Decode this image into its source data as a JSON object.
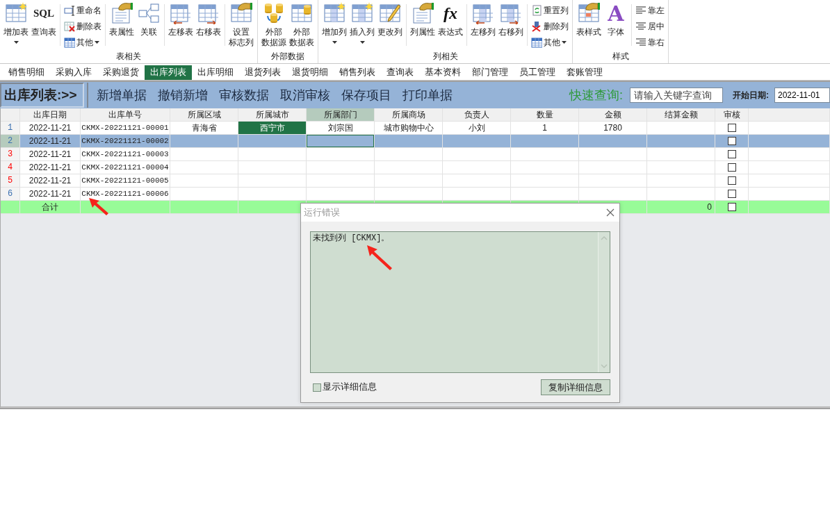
{
  "ribbon": {
    "groups": [
      {
        "label": "表相关",
        "items": [
          {
            "kind": "large",
            "label": "增加表",
            "dropdown": true
          },
          {
            "kind": "large",
            "label": "查询表",
            "icon_text": "SQL",
            "dropdown": false
          },
          {
            "kind": "separator"
          },
          {
            "kind": "stack",
            "items": [
              {
                "label": "重命名",
                "dropdown": false
              },
              {
                "label": "删除表",
                "dropdown": false
              },
              {
                "label": "其他",
                "dropdown": true
              }
            ]
          },
          {
            "kind": "separator"
          },
          {
            "kind": "large",
            "label": "表属性",
            "dropdown": false
          },
          {
            "kind": "large",
            "label": "关联",
            "dropdown": false
          },
          {
            "kind": "separator"
          },
          {
            "kind": "large",
            "label": "左移表",
            "dropdown": false
          },
          {
            "kind": "large",
            "label": "右移表",
            "dropdown": false
          },
          {
            "kind": "separator"
          },
          {
            "kind": "large",
            "label": [
              "设置",
              "标志列"
            ],
            "dropdown": false
          }
        ]
      },
      {
        "label": "外部数据",
        "items": [
          {
            "kind": "large",
            "label": [
              "外部",
              "数据源"
            ],
            "dropdown": false
          },
          {
            "kind": "large",
            "label": [
              "外部",
              "数据表"
            ],
            "dropdown": false
          }
        ]
      },
      {
        "label": "列相关",
        "items": [
          {
            "kind": "large",
            "label": "增加列",
            "dropdown": true
          },
          {
            "kind": "large",
            "label": "插入列",
            "dropdown": true
          },
          {
            "kind": "large",
            "label": "更改列",
            "dropdown": false
          },
          {
            "kind": "separator"
          },
          {
            "kind": "large",
            "label": "列属性",
            "dropdown": false
          },
          {
            "kind": "large",
            "label": "表达式",
            "icon_text": "fx",
            "dropdown": false
          },
          {
            "kind": "separator"
          },
          {
            "kind": "large",
            "label": "左移列",
            "dropdown": false
          },
          {
            "kind": "large",
            "label": "右移列",
            "dropdown": false
          },
          {
            "kind": "separator"
          },
          {
            "kind": "stack",
            "items": [
              {
                "label": "重置列",
                "dropdown": false
              },
              {
                "label": "删除列",
                "dropdown": false
              },
              {
                "label": "其他",
                "dropdown": true
              }
            ]
          }
        ]
      },
      {
        "label": "样式",
        "items": [
          {
            "kind": "large",
            "label": "表样式",
            "dropdown": false
          },
          {
            "kind": "large",
            "label": "字体",
            "icon_text": "A",
            "dropdown": false
          },
          {
            "kind": "separator"
          },
          {
            "kind": "stack",
            "items": [
              {
                "label": "靠左",
                "dropdown": false
              },
              {
                "label": "居中",
                "dropdown": false
              },
              {
                "label": "靠右",
                "dropdown": false
              }
            ]
          }
        ]
      }
    ]
  },
  "tabs": [
    {
      "label": "销售明细",
      "selected": false
    },
    {
      "label": "采购入库",
      "selected": false
    },
    {
      "label": "采购退货",
      "selected": false
    },
    {
      "label": "出库列表",
      "selected": true
    },
    {
      "label": "出库明细",
      "selected": false
    },
    {
      "label": "退货列表",
      "selected": false
    },
    {
      "label": "退货明细",
      "selected": false
    },
    {
      "label": "销售列表",
      "selected": false
    },
    {
      "label": "查询表",
      "selected": false
    },
    {
      "label": "基本资料",
      "selected": false
    },
    {
      "label": "部门管理",
      "selected": false
    },
    {
      "label": "员工管理",
      "selected": false
    },
    {
      "label": "套账管理",
      "selected": false
    }
  ],
  "toolbar": {
    "title": "出库列表:>>",
    "actions": [
      "新增单据",
      "撤销新增",
      "审核数据",
      "取消审核",
      "保存项目",
      "打印单据"
    ],
    "quick_search_label": "快速查询:",
    "search": {
      "placeholder": "请输入关键字查询"
    },
    "date_label": "开始日期:",
    "start_date": "2022-11-01"
  },
  "table": {
    "columns": [
      {
        "label": "出库日期",
        "selected": false
      },
      {
        "label": "出库单号",
        "selected": false
      },
      {
        "label": "所属区域",
        "selected": false
      },
      {
        "label": "所属城市",
        "selected": false
      },
      {
        "label": "所属部门",
        "selected": true
      },
      {
        "label": "所属商场",
        "selected": false
      },
      {
        "label": "负责人",
        "selected": false
      },
      {
        "label": "数量",
        "selected": false
      },
      {
        "label": "金额",
        "selected": false
      },
      {
        "label": "结算金额",
        "selected": false
      },
      {
        "label": "审核",
        "selected": false
      }
    ],
    "rows": [
      {
        "number": "1",
        "color": "#3a6fb0",
        "selected": false,
        "checked": false,
        "cells": [
          {
            "text": "2022-11-21",
            "highlighted": false,
            "focused": false
          },
          {
            "text": "CKMX-20221121-00001",
            "highlighted": false,
            "focused": false
          },
          {
            "text": "青海省",
            "highlighted": false,
            "focused": false
          },
          {
            "text": "西宁市",
            "highlighted": true,
            "focused": false
          },
          {
            "text": "刘宗国",
            "highlighted": false,
            "focused": false
          },
          {
            "text": "城市购物中心",
            "highlighted": false,
            "focused": false
          },
          {
            "text": "小刘",
            "highlighted": false,
            "focused": false
          },
          {
            "text": "1",
            "highlighted": false,
            "focused": false
          },
          {
            "text": "1780",
            "highlighted": false,
            "focused": false
          }
        ]
      },
      {
        "number": "2",
        "color": "#3a6fb0",
        "selected": true,
        "checked": false,
        "cells": [
          {
            "text": "2022-11-21",
            "highlighted": false,
            "focused": false
          },
          {
            "text": "CKMX-20221121-00002",
            "highlighted": false,
            "focused": false
          },
          {
            "highlighted": false,
            "focused": false
          },
          {
            "highlighted": false,
            "focused": false
          },
          {
            "highlighted": false,
            "focused": true
          }
        ]
      },
      {
        "number": "3",
        "color": "#ff0000",
        "selected": false,
        "checked": false,
        "cells": [
          {
            "text": "2022-11-21",
            "highlighted": false,
            "focused": false
          },
          {
            "text": "CKMX-20221121-00003",
            "highlighted": false,
            "focused": false
          }
        ]
      },
      {
        "number": "4",
        "color": "#ff0000",
        "selected": false,
        "checked": false,
        "cells": [
          {
            "text": "2022-11-21",
            "highlighted": false,
            "focused": false
          },
          {
            "text": "CKMX-20221121-00004",
            "highlighted": false,
            "focused": false
          }
        ]
      },
      {
        "number": "5",
        "color": "#ff0000",
        "selected": false,
        "checked": false,
        "cells": [
          {
            "text": "2022-11-21",
            "highlighted": false,
            "focused": false
          },
          {
            "text": "CKMX-20221121-00005",
            "highlighted": false,
            "focused": false
          }
        ]
      },
      {
        "number": "6",
        "color": "#3a6fb0",
        "selected": false,
        "checked": false,
        "cells": [
          {
            "text": "2022-11-21",
            "highlighted": false,
            "focused": false
          },
          {
            "text": "CKMX-20221121-00006",
            "highlighted": false,
            "focused": false
          }
        ]
      }
    ],
    "total": {
      "label": "合计",
      "settlement_total": "0",
      "checked": false
    }
  },
  "dialog": {
    "title": "运行错误",
    "message": "未找到列 [CKMX]。",
    "details_label": "显示详细信息",
    "details_checked": false,
    "copy_button": "复制详细信息"
  }
}
